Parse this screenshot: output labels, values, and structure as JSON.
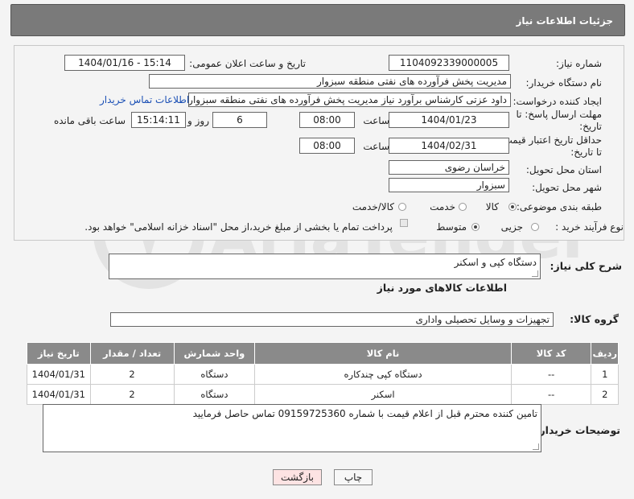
{
  "header": {
    "title": "جزئیات اطلاعات نیاز"
  },
  "fields": {
    "need_number_label": "شماره نیاز:",
    "need_number": "1104092339000005",
    "announce_label": "تاریخ و ساعت اعلان عمومی:",
    "announce_value": "1404/01/16 - 15:14",
    "buyer_org_label": "نام دستگاه خریدار:",
    "buyer_org": "مدیریت پخش فرآورده های نفتی منطقه سبزوار",
    "creator_label": "ایجاد کننده درخواست:",
    "creator": "داود عزتی کارشناس برآورد نیاز مدیریت پخش فرآورده های نفتی منطقه سبزوار",
    "contact_link": "اطلاعات تماس خریدار",
    "deadline_label_1": "مهلت ارسال پاسخ: تا",
    "deadline_label_2": "تاریخ:",
    "deadline_date": "1404/01/23",
    "time_label": "ساعت",
    "deadline_time": "08:00",
    "days_value": "6",
    "days_label": "روز و",
    "remaining_time": "15:14:11",
    "remaining_label": "ساعت باقی مانده",
    "validity_label_1": "حداقل تاریخ اعتبار قیمت:",
    "validity_label_2": "تا تاریخ:",
    "validity_date": "1404/02/31",
    "validity_time": "08:00",
    "province_label": "استان محل تحویل:",
    "province": "خراسان رضوی",
    "city_label": "شهر محل تحویل:",
    "city": "سبزوار",
    "category_label": "طبقه بندی موضوعی:",
    "category_options": [
      "کالا",
      "خدمت",
      "کالا/خدمت"
    ],
    "purchase_type_label": "نوع فرآیند خرید :",
    "purchase_options": [
      "جزیی",
      "متوسط"
    ],
    "payment_note": "پرداخت تمام یا بخشی از مبلغ خرید،از محل \"اسناد خزانه اسلامی\" خواهد بود."
  },
  "description": {
    "label": "شرح کلی نیاز:",
    "value": "دستگاه کپی و اسکنر"
  },
  "goods_section": {
    "title": "اطلاعات کالاهای مورد نیاز",
    "group_label": "گروه کالا:",
    "group_value": "تجهیزات و وسایل تحصیلی واداری"
  },
  "table": {
    "headers": [
      "ردیف",
      "کد کالا",
      "نام کالا",
      "واحد شمارش",
      "تعداد / مقدار",
      "تاریخ نیاز"
    ],
    "rows": [
      [
        "1",
        "--",
        "دستگاه کپی چندکاره",
        "دستگاه",
        "2",
        "1404/01/31"
      ],
      [
        "2",
        "--",
        "اسکنر",
        "دستگاه",
        "2",
        "1404/01/31"
      ]
    ]
  },
  "buyer_notes": {
    "label": "توضیحات خریدار:",
    "value": "تامین کننده محترم قبل از اعلام قیمت با شماره 09159725360 تماس حاصل فرمایید"
  },
  "buttons": {
    "print": "چاپ",
    "back": "بازگشت"
  },
  "watermark": {
    "text": "AriaTender.neT"
  },
  "colors": {
    "header_bg": "#7a7a7a",
    "table_header_bg": "#8a8a8a",
    "link": "#1a4fb5",
    "back_button_bg": "#fde3e3"
  }
}
